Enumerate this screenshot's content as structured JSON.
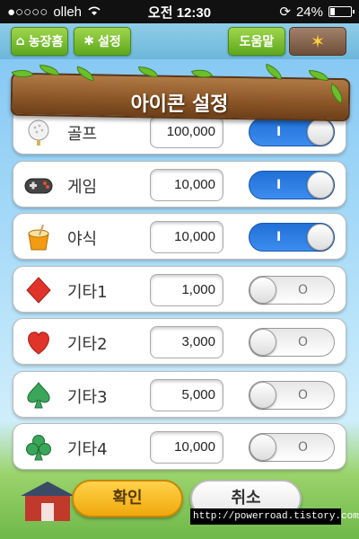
{
  "status_bar": {
    "carrier": "olleh",
    "time": "오전 12:30",
    "battery": "24%",
    "battery_level": 0.24
  },
  "top_bar": {
    "farm_home_label": "농장홈",
    "settings_label": "설정",
    "help_label": "도움말"
  },
  "title": "아이콘 설정",
  "items": [
    {
      "label": "골프",
      "value": "100,000",
      "enabled": true,
      "icon": "golf-ball-icon"
    },
    {
      "label": "게임",
      "value": "10,000",
      "enabled": true,
      "icon": "gamepad-icon"
    },
    {
      "label": "야식",
      "value": "10,000",
      "enabled": true,
      "icon": "noodle-cup-icon"
    },
    {
      "label": "기타1",
      "value": "1,000",
      "enabled": false,
      "icon": "diamond-icon"
    },
    {
      "label": "기타2",
      "value": "3,000",
      "enabled": false,
      "icon": "heart-icon"
    },
    {
      "label": "기타3",
      "value": "5,000",
      "enabled": false,
      "icon": "spade-icon"
    },
    {
      "label": "기타4",
      "value": "10,000",
      "enabled": false,
      "icon": "club-icon"
    }
  ],
  "toggle_text": {
    "on": "I",
    "off": "O"
  },
  "buttons": {
    "confirm": "확인",
    "cancel": "취소"
  },
  "watermark": "http://powerroad.tistory.com",
  "colors": {
    "toggle_on": "#2a7ae4",
    "green_button": "#6fb82a",
    "wood": "#8a5526"
  }
}
